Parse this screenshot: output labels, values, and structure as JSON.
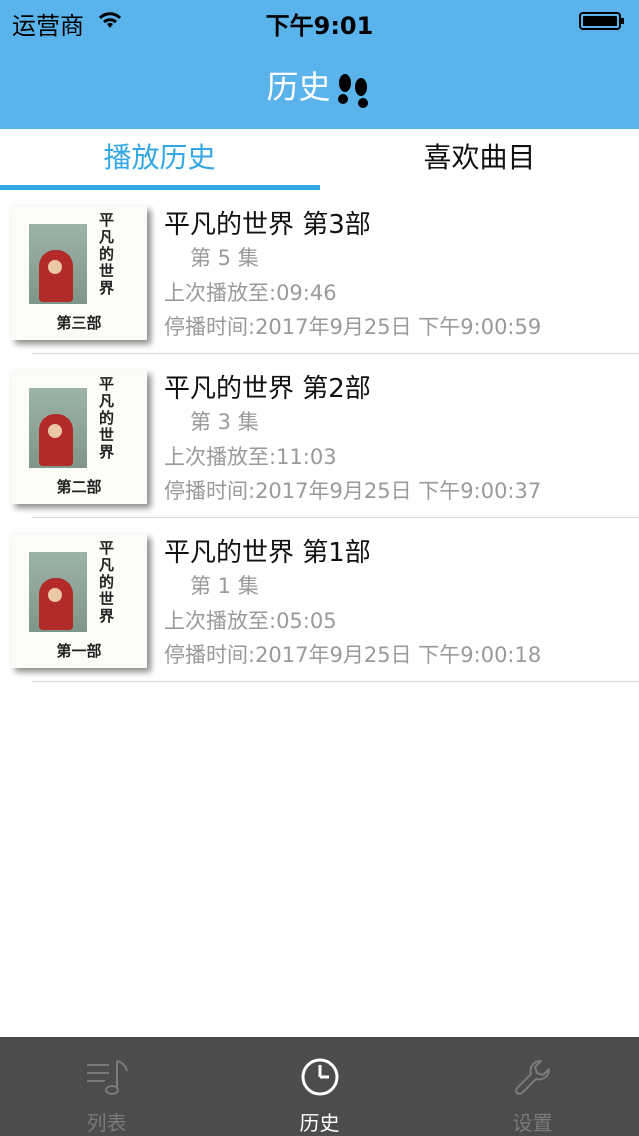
{
  "status_bar": {
    "carrier": "运营商",
    "time": "下午9:01"
  },
  "nav": {
    "title": "历史"
  },
  "tabs": [
    {
      "label": "播放历史",
      "selected": true
    },
    {
      "label": "喜欢曲目",
      "selected": false
    }
  ],
  "items": [
    {
      "title": "平凡的世界 第3部",
      "episode": "第 5 集",
      "last_played": "上次播放至:09:46",
      "stop_time": "停播时间:2017年9月25日 下午9:00:59",
      "cover_title": "平凡的世界",
      "cover_part": "第三部"
    },
    {
      "title": "平凡的世界 第2部",
      "episode": "第 3 集",
      "last_played": "上次播放至:11:03",
      "stop_time": "停播时间:2017年9月25日 下午9:00:37",
      "cover_title": "平凡的世界",
      "cover_part": "第二部"
    },
    {
      "title": "平凡的世界 第1部",
      "episode": "第 1 集",
      "last_played": "上次播放至:05:05",
      "stop_time": "停播时间:2017年9月25日 下午9:00:18",
      "cover_title": "平凡的世界",
      "cover_part": "第一部"
    }
  ],
  "tab_bar": [
    {
      "label": "列表",
      "icon": "music-list-icon",
      "active": false
    },
    {
      "label": "历史",
      "icon": "clock-icon",
      "active": true
    },
    {
      "label": "设置",
      "icon": "wrench-icon",
      "active": false
    }
  ],
  "colors": {
    "nav_bg": "#5ab3ea",
    "accent": "#34a8e4",
    "tabbar_bg": "#4c4c4c"
  }
}
